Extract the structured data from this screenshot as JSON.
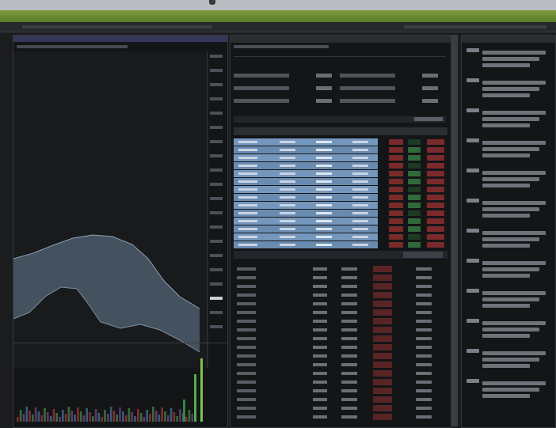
{
  "window": {
    "accent": "#6f8c35"
  },
  "menubar": {
    "items": [
      "",
      "",
      "",
      "",
      "",
      ""
    ]
  },
  "left_panel": {
    "title": "",
    "subtitle": "",
    "price_ticks": [
      "",
      "",
      "",
      "",
      "",
      "",
      "",
      "",
      "",
      "",
      "",
      "",
      "",
      "",
      "",
      "",
      "",
      "",
      "",
      ""
    ]
  },
  "center_panel": {
    "title": "",
    "quote_fields": [
      {
        "label": "",
        "value": ""
      },
      {
        "label": "",
        "value": ""
      },
      {
        "label": "",
        "value": ""
      },
      {
        "label": "",
        "value": ""
      },
      {
        "label": "",
        "value": ""
      },
      {
        "label": "",
        "value": ""
      }
    ],
    "grid_rows": 14,
    "lower_rows": 18
  },
  "right_panel": {
    "title": "",
    "news_count": 12
  },
  "colors": {
    "background": "#1b1c1e",
    "highlight": "#6f8fb4",
    "down": "#7a2a2a",
    "up": "#2f6a3a"
  }
}
